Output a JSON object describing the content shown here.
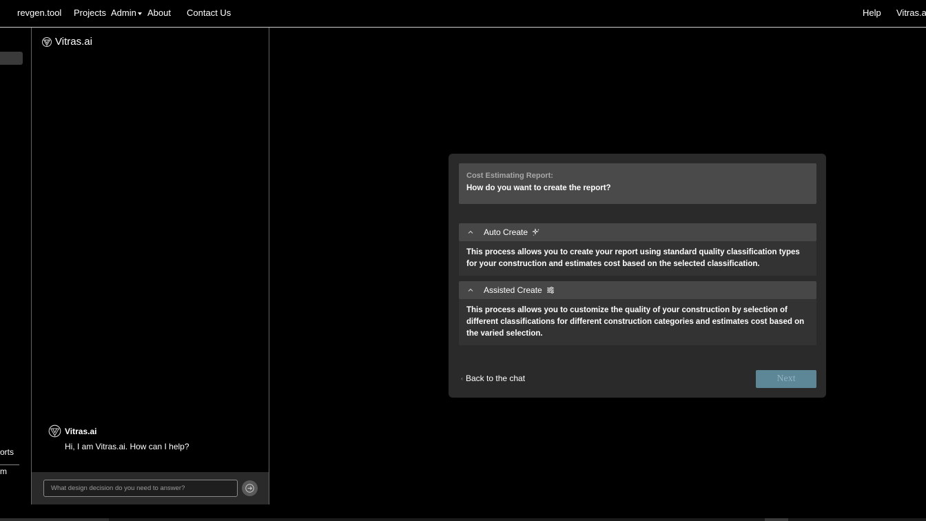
{
  "nav": {
    "brand": "revgen.tool",
    "projects": "Projects",
    "admin": "Admin",
    "about": "About",
    "contact": "Contact Us",
    "help": "Help",
    "user": "Vitras.ai"
  },
  "sidebar": {
    "item_partial_1": "orts",
    "item_partial_2": "m"
  },
  "chat": {
    "brand": "Vitras.ai",
    "message_author": "Vitras.ai",
    "message_text": "Hi, I am Vitras.ai. How can I help?",
    "input_placeholder": "What design decision do you need to answer?",
    "send_icon": "arrow-right-icon"
  },
  "modal": {
    "subtitle": "Cost Estimating Report:",
    "title": "How do you want to create the report?",
    "options": [
      {
        "label": "Auto Create",
        "icon": "sparkles-icon",
        "description": "This process allows you to create your report using standard quality classification types for your construction and estimates cost based on the selected classification."
      },
      {
        "label": "Assisted Create",
        "icon": "sliders-icon",
        "description": "This process allows you to customize the quality of your construction by selection of different classifications for different construction categories and estimates cost based on the varied selection."
      }
    ],
    "back_label": "Back to the chat",
    "next_label": "Next"
  }
}
